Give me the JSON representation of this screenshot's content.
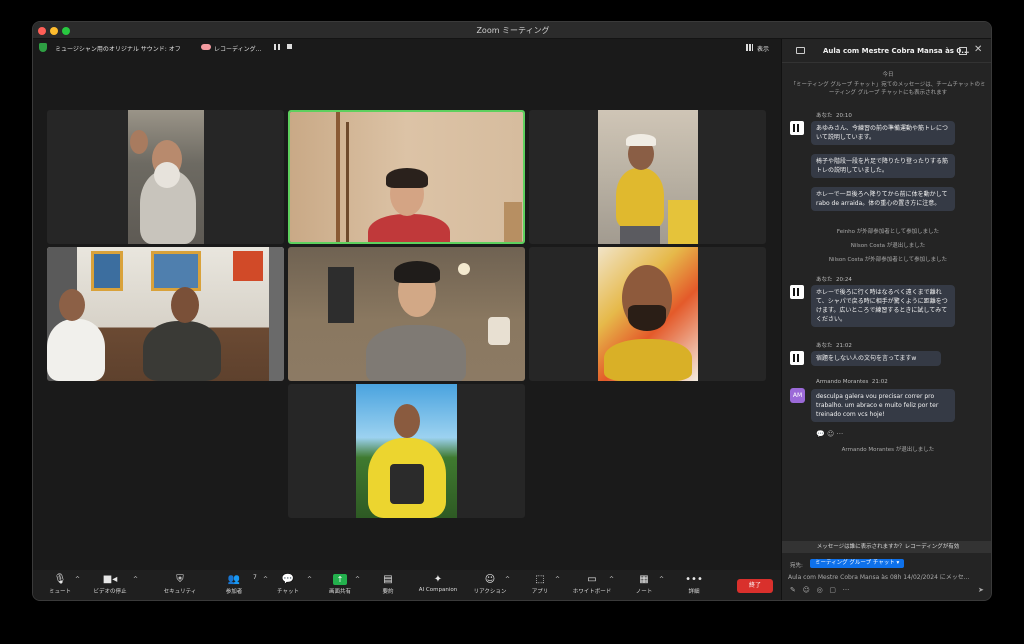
{
  "window": {
    "title": "Zoom ミーティング"
  },
  "topbar": {
    "audio_label": "ミュージシャン用のオリジナル サウンド: オフ",
    "recording_label": "レコーディング...",
    "view_label": "表示"
  },
  "chat": {
    "title": "Aula com Mestre Cobra Mansa às 0...",
    "date_divider": "今日",
    "notice": "「ミーティング グループ チャット」宛てのメッセージは、チームチャットのミーティング グループ チャットにも表示されます",
    "messages": [
      {
        "sender": "あなた",
        "time": "20:10",
        "lines": [
          "あゆみさん、今練習の前の準備運動や筋トレについて説明しています。",
          "椅子や階段一段を片足で降りたり登ったりする筋トレの説明していました。",
          "ホレーで一旦後ろへ降りてから前に体を動かして rabo de arraida。体の重心の置き方に注意。"
        ]
      },
      {
        "sender": "あなた",
        "time": "20:24",
        "lines": [
          "ホレーで後ろに行く時はなるべく遠くまで離れて、シャパで戻る時に相手が驚くように距離をつけます。広いところで練習するときに試してみてください。"
        ]
      },
      {
        "sender": "あなた",
        "time": "21:02",
        "lines": [
          "宿題をしない人の文句を言ってますw"
        ]
      },
      {
        "sender": "Armando Morantes",
        "time": "21:02",
        "initials": "AM",
        "lines": [
          "desculpa galera vou precisar correr pro trabalho.  um abraco e muito feliz por ter treinado com vcs hoje!"
        ]
      }
    ],
    "system_messages": [
      "Feinho が外部参加者として参加しました",
      "Nilson Costa が退出しました",
      "Nilson Costa が外部参加者として参加しました",
      "Armando Morantes が退出しました"
    ],
    "recording_notice": "メッセージは誰に表示されますか？レコーディングが有効",
    "to_label": "宛先:",
    "to_value": "ミーティング グループ チャット ▾",
    "input_value": "Aula com Mestre Cobra Mansa às 08h 14/02/2024 にメッセ..."
  },
  "toolbar": {
    "mute": "ミュート",
    "video": "ビデオの停止",
    "security": "セキュリティ",
    "participants": "参加者",
    "participants_count": "7",
    "chat": "チャット",
    "share": "画面共有",
    "summary": "要約",
    "ai": "AI Companion",
    "reactions": "リアクション",
    "apps": "アプリ",
    "whiteboard": "ホワイトボード",
    "notes": "ノート",
    "more": "詳細",
    "end": "終了"
  }
}
